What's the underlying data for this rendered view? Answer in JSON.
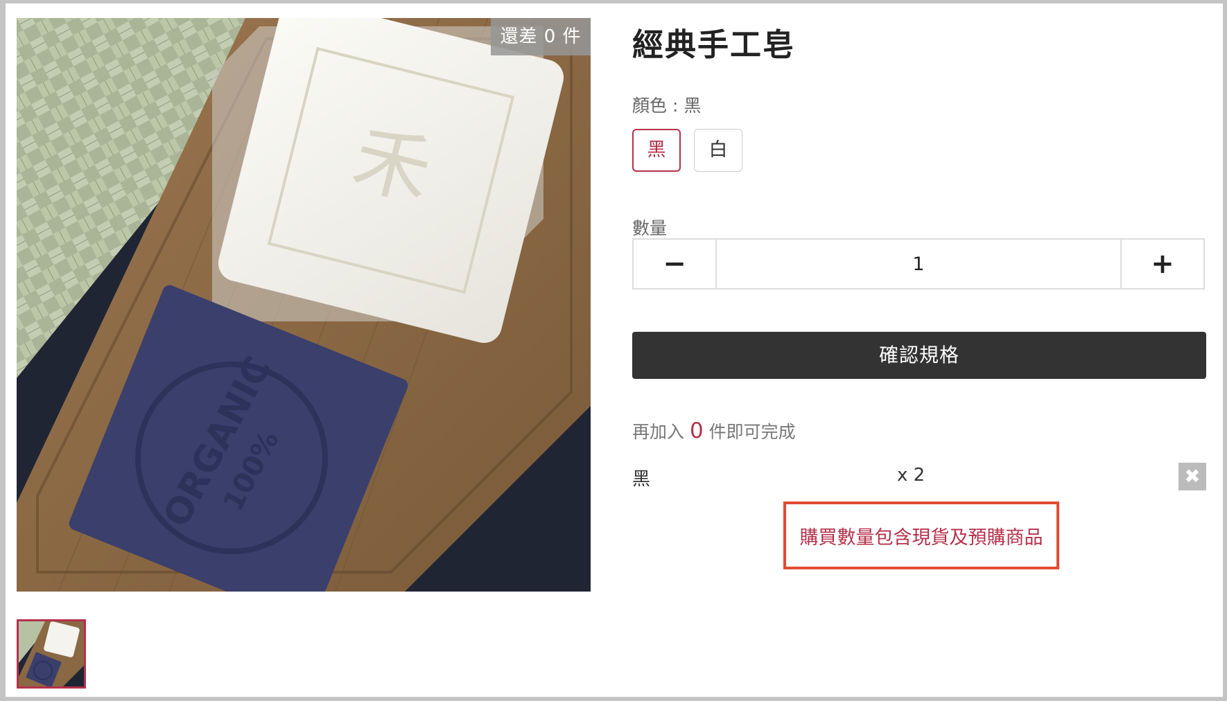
{
  "product": {
    "title": "經典手工皂",
    "remaining_badge": "還差 0 件"
  },
  "color": {
    "label": "顏色 : 黑",
    "options": [
      {
        "label": "黑",
        "selected": true
      },
      {
        "label": "白",
        "selected": false
      }
    ]
  },
  "quantity": {
    "label": "數量",
    "minus": "−",
    "value": "1",
    "plus": "+"
  },
  "confirm_button": "確認規格",
  "progress": {
    "prefix": "再加入 ",
    "count": "0",
    "suffix": " 件即可完成"
  },
  "selected_items": [
    {
      "name": "黑",
      "qty": "x 2"
    }
  ],
  "remove_icon": "✖",
  "notice": "購買數量包含現貨及預購商品",
  "colors": {
    "accent": "#b5304b",
    "notice_border": "#e14c31",
    "button_dark": "#333333"
  }
}
